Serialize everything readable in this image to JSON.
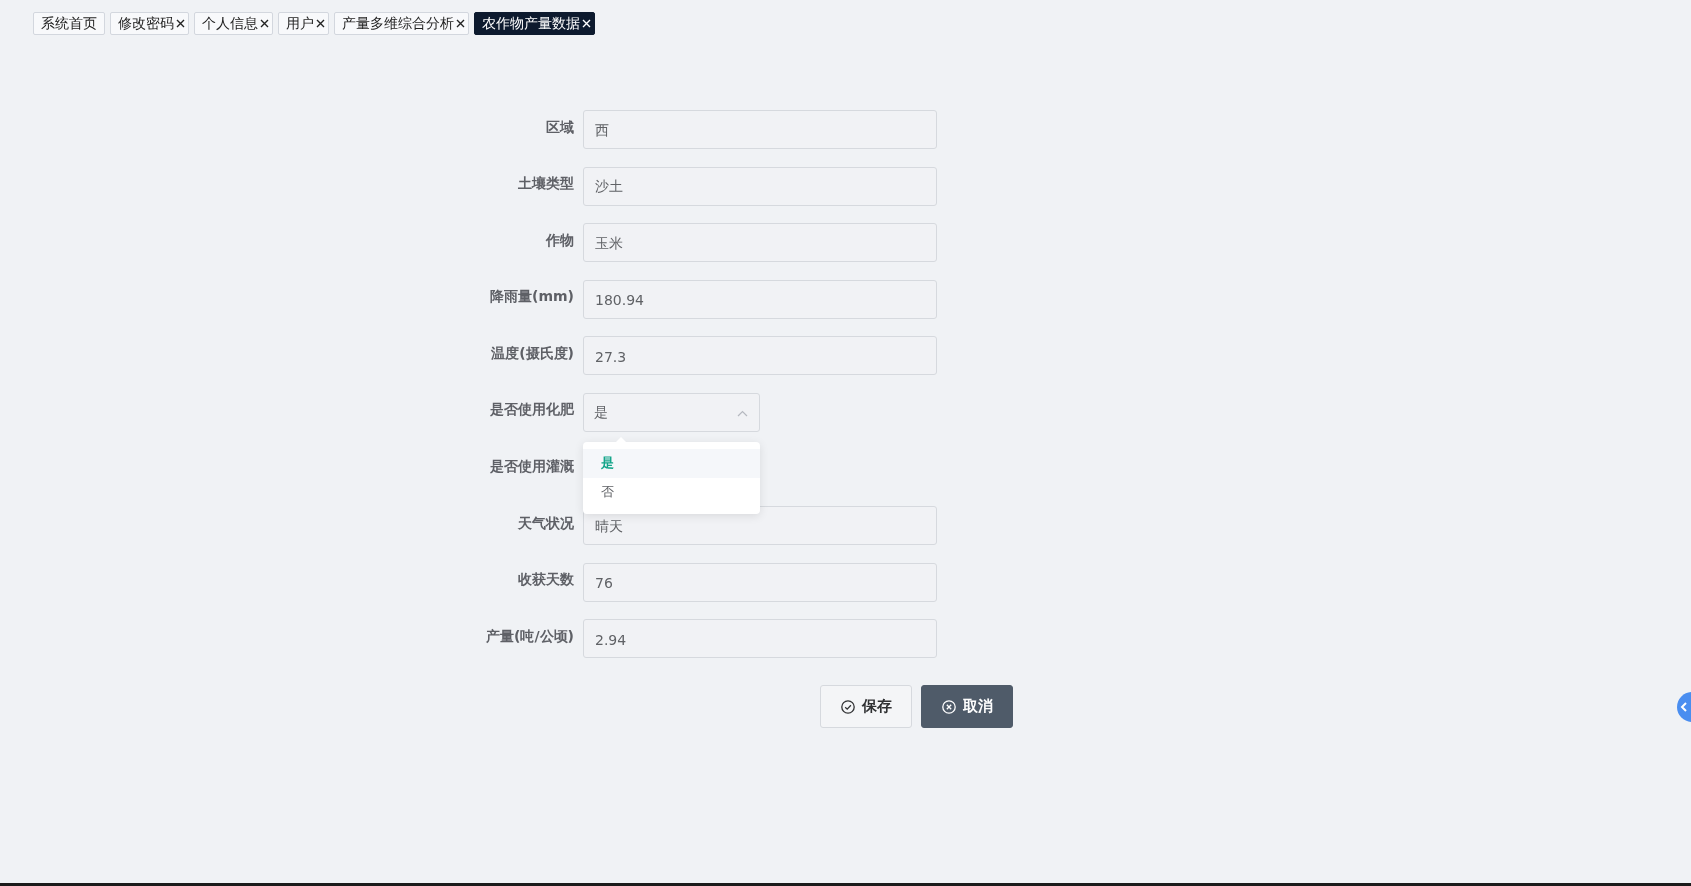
{
  "tabs": [
    {
      "label": "系统首页",
      "closable": false,
      "selected": false
    },
    {
      "label": "修改密码",
      "closable": true,
      "selected": false
    },
    {
      "label": "个人信息",
      "closable": true,
      "selected": false
    },
    {
      "label": "用户",
      "closable": true,
      "selected": false
    },
    {
      "label": "产量多维综合分析",
      "closable": true,
      "selected": false
    },
    {
      "label": "农作物产量数据",
      "closable": true,
      "selected": true
    }
  ],
  "form": {
    "fields": [
      {
        "kind": "text",
        "label": "区域",
        "value": "西"
      },
      {
        "kind": "text",
        "label": "土壤类型",
        "value": "沙土"
      },
      {
        "kind": "text",
        "label": "作物",
        "value": "玉米"
      },
      {
        "kind": "text",
        "label": "降雨量(mm)",
        "value": "180.94"
      },
      {
        "kind": "text",
        "label": "温度(摄氏度)",
        "value": "27.3"
      },
      {
        "kind": "select",
        "label": "是否使用化肥",
        "value": "是",
        "expanded": true,
        "options": [
          {
            "label": "是",
            "selected": true
          },
          {
            "label": "否",
            "selected": false
          }
        ]
      },
      {
        "kind": "covered",
        "label": "是否使用灌溉"
      },
      {
        "kind": "text",
        "label": "天气状况",
        "value": "晴天"
      },
      {
        "kind": "text",
        "label": "收获天数",
        "value": "76"
      },
      {
        "kind": "text",
        "label": "产量(吨/公顷)",
        "value": "2.94"
      }
    ],
    "buttons": [
      {
        "kind": "save",
        "label": "保存"
      },
      {
        "kind": "cancel",
        "label": "取消"
      }
    ]
  }
}
